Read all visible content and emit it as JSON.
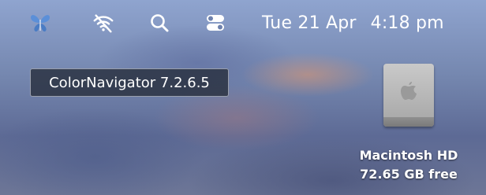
{
  "menubar": {
    "icons": [
      "colornavigator-butterfly-icon",
      "wifi-off-icon",
      "spotlight-search-icon",
      "control-center-icon"
    ],
    "date": "Tue 21 Apr",
    "time": "4:18 pm"
  },
  "tooltip": {
    "text": "ColorNavigator 7.2.6.5"
  },
  "desktop": {
    "drive": {
      "name": "Macintosh HD",
      "free": "72.65 GB free"
    }
  },
  "colors": {
    "butterfly_icon": "#5b8fd8",
    "menubar_text": "#ffffff",
    "tooltip_bg": "#28303e"
  }
}
